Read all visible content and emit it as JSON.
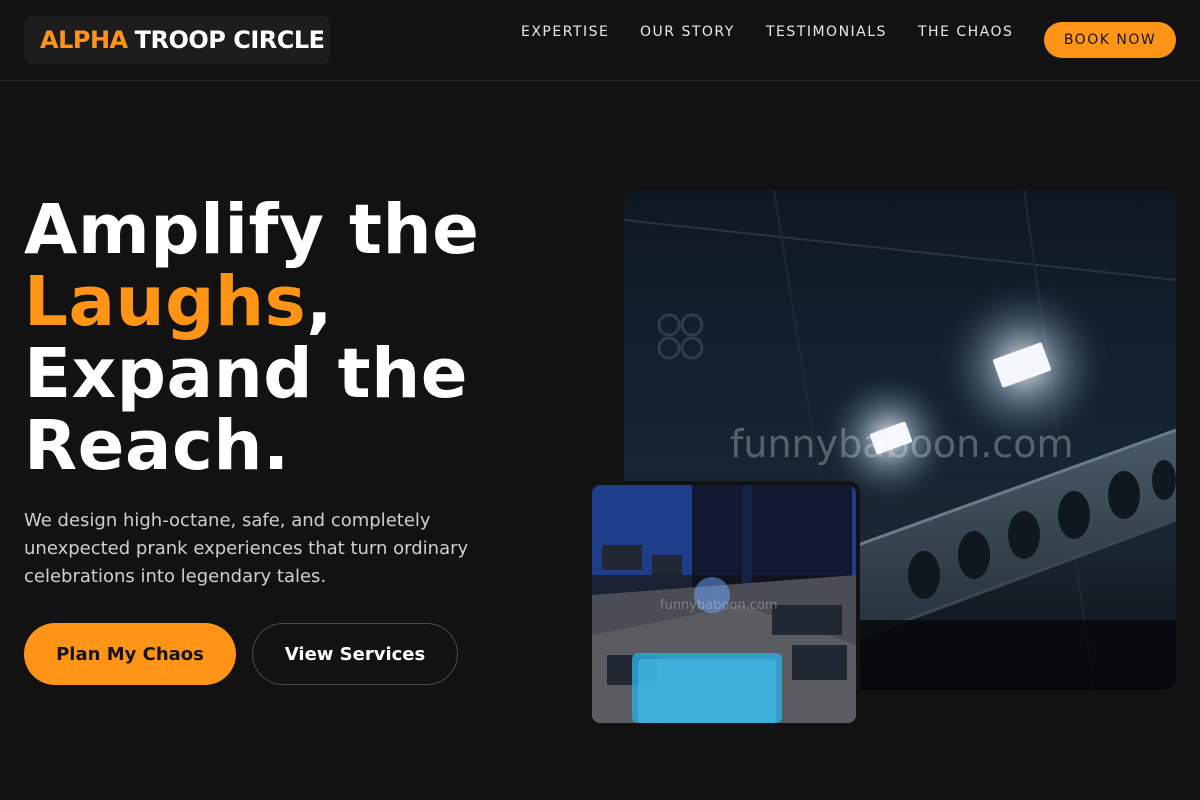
{
  "brand": {
    "accent_word": "ALPHA",
    "rest": "TROOP CIRCLE",
    "accent_color": "#ff9416"
  },
  "nav": {
    "items": [
      {
        "label": "EXPERTISE"
      },
      {
        "label": "OUR STORY"
      },
      {
        "label": "TESTIMONIALS"
      },
      {
        "label": "THE CHAOS"
      }
    ],
    "cta": "BOOK NOW"
  },
  "hero": {
    "title_line1": "Amplify the",
    "title_highlight": "Laughs",
    "title_comma": ",",
    "title_line3": "Expand the",
    "title_line4": "Reach.",
    "subtitle_lines": [
      "We design high-octane, safe, and completely",
      "unexpected prank experiences that turn ordinary",
      "celebrations into legendary tales."
    ],
    "primary_cta": "Plan My Chaos",
    "secondary_cta": "View Services"
  },
  "images": {
    "main_watermark": "funnybaboon.com",
    "small_watermark": "funnybaboon.com"
  }
}
